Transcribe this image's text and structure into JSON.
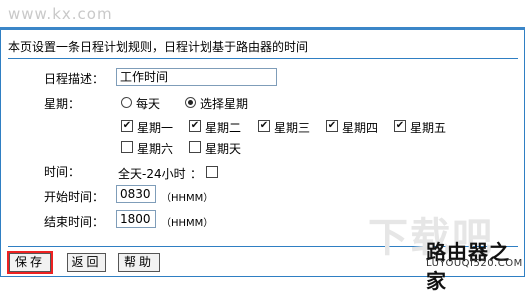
{
  "window": {
    "title": "www.kx.com"
  },
  "description": "本页设置一条日程计划规则，日程计划基于路由器的时间",
  "schedule": {
    "desc_label": "日程描述：",
    "desc_value": "工作时间",
    "week_label": "星期：",
    "radio_everyday": "每天",
    "radio_select": "选择星期",
    "days": [
      {
        "label": "星期一",
        "checked": true
      },
      {
        "label": "星期二",
        "checked": true
      },
      {
        "label": "星期三",
        "checked": true
      },
      {
        "label": "星期四",
        "checked": true
      },
      {
        "label": "星期五",
        "checked": true
      },
      {
        "label": "星期六",
        "checked": false
      },
      {
        "label": "星期天",
        "checked": false
      }
    ],
    "time_label": "时间：",
    "allday_label": "全天-24小时",
    "allday_sep": "：",
    "start_label": "开始时间：",
    "start_value": "0830",
    "end_label": "结束时间：",
    "end_value": "1800",
    "hint": "（HHMM）"
  },
  "buttons": {
    "save": "保存",
    "back": "返回",
    "help": "帮助"
  },
  "watermark": {
    "big": "下载吧",
    "brand": "路由器之家",
    "url": "LUYOUQI520.COM"
  },
  "colors": {
    "accent": "#2f7fc3",
    "highlight": "#e22222"
  }
}
